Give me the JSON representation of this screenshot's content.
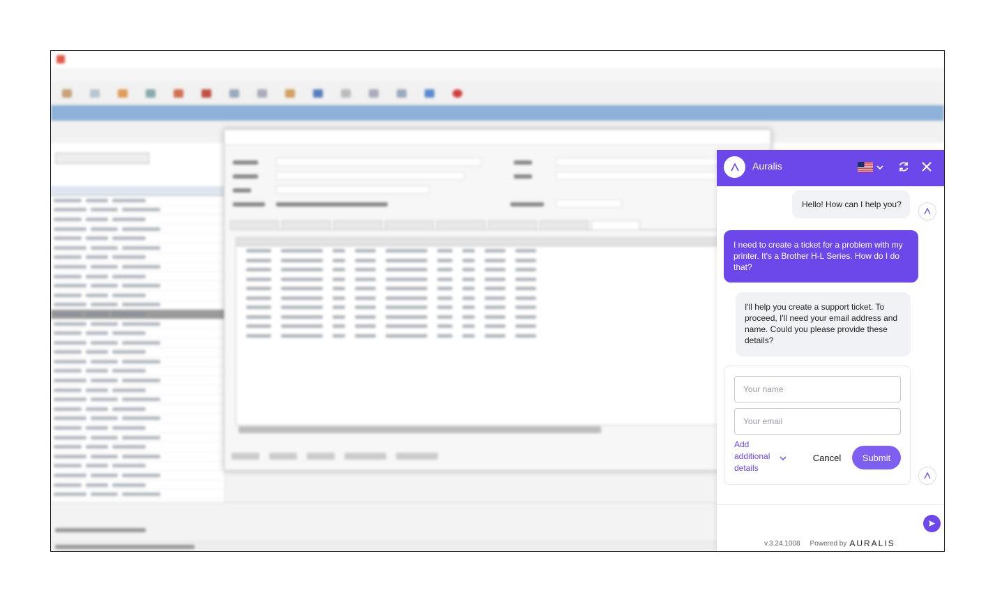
{
  "chat": {
    "brand_name": "Auralis",
    "header_icons": [
      "logo-icon",
      "us-flag-icon",
      "chevron-down-icon",
      "refresh-icon",
      "close-icon"
    ],
    "accent_color": "#6c47ea",
    "messages": [
      {
        "role": "bot",
        "text": "Hello! How can I help you?"
      },
      {
        "role": "user",
        "text": "I need to create a ticket for a problem with my printer. It's a Brother H-L Series. How do I do that?"
      },
      {
        "role": "bot",
        "text": "I'll help you create a support ticket. To proceed, I'll need your email address and name. Could you please provide these details?"
      }
    ],
    "form": {
      "name_placeholder": "Your name",
      "email_placeholder": "Your email",
      "add_details_label": "Add additional details",
      "cancel_label": "Cancel",
      "submit_label": "Submit"
    },
    "composer": {
      "placeholder": ""
    },
    "footer": {
      "version": "v.3.24.1008",
      "powered_by": "Powered by",
      "powered_logo": "AURALIS"
    }
  }
}
